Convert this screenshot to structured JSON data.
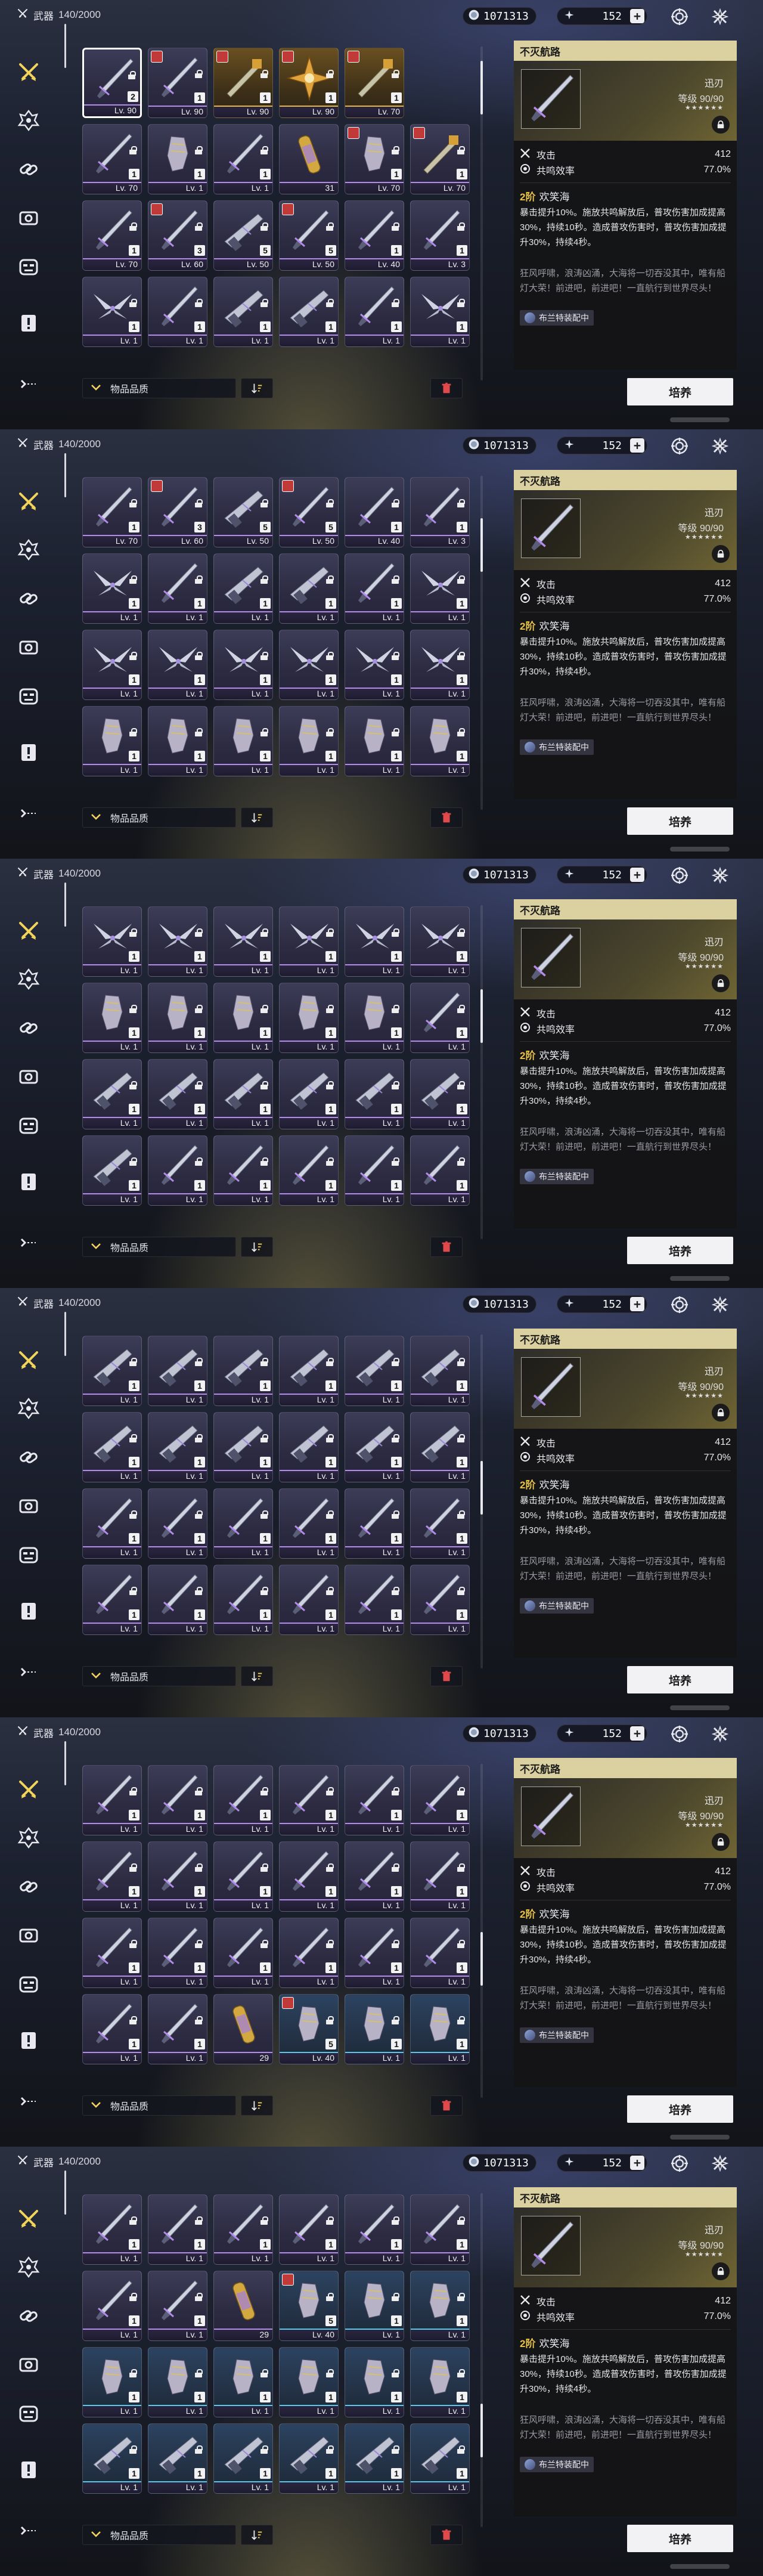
{
  "header": {
    "title": "武器",
    "count": "140/2000",
    "credits": "1071313",
    "gems": "152"
  },
  "filter": {
    "label": "物品品质"
  },
  "detail": {
    "name": "不灭航路",
    "type": "迅刃",
    "level": "等级 90/90",
    "stars": "★★★★★★",
    "stats": [
      {
        "label": "攻击",
        "value": "412"
      },
      {
        "label": "共鸣效率",
        "value": "77.0%"
      }
    ],
    "skill_tier": "2阶",
    "skill_name": "欢笑海",
    "skill_desc": "暴击提升10%。施放共鸣解放后，普攻伤害加成提高30%，持续10秒。造成普攻伤害时，普攻伤害加成提升30%，持续4秒。",
    "flavor": "狂风呼啸，浪涛凶涌，大海将一切吞没其中，唯有船灯大荣！前进吧，前进吧！一直航行到世界尽头！",
    "equipped_by": "布兰特装配中",
    "upgrade_label": "培养"
  },
  "panels": [
    {
      "thumb_row": 0,
      "rows": [
        [
          {
            "lv": "Lv. 90",
            "n": "2",
            "r": "p",
            "w": "sword",
            "sel": true,
            "badge": false
          },
          {
            "lv": "Lv. 90",
            "n": "1",
            "r": "p",
            "w": "sword",
            "badge": true
          },
          {
            "lv": "Lv. 90",
            "n": "1",
            "r": "g",
            "w": "rect",
            "badge": true
          },
          {
            "lv": "Lv. 90",
            "n": "1",
            "r": "g",
            "w": "star",
            "badge": true
          },
          {
            "lv": "Lv. 70",
            "n": "1",
            "r": "g",
            "w": "rect",
            "badge": true
          }
        ],
        [
          {
            "lv": "Lv. 70",
            "n": "1",
            "r": "p",
            "w": "sword"
          },
          {
            "lv": "Lv. 1",
            "n": "1",
            "r": "p",
            "w": "gauntlet"
          },
          {
            "lv": "Lv. 1",
            "n": "1",
            "r": "p",
            "w": "sword"
          },
          {
            "lv": "31",
            "n": "",
            "r": "p",
            "w": "tube"
          },
          {
            "lv": "Lv. 70",
            "n": "1",
            "r": "p",
            "w": "gauntlet",
            "badge": true
          },
          {
            "lv": "Lv. 70",
            "n": "1",
            "r": "p",
            "w": "rect",
            "badge": true
          }
        ],
        [
          {
            "lv": "Lv. 70",
            "n": "1",
            "r": "p",
            "w": "sword"
          },
          {
            "lv": "Lv. 60",
            "n": "3",
            "r": "p",
            "w": "sword",
            "badge": true
          },
          {
            "lv": "Lv. 50",
            "n": "5",
            "r": "p",
            "w": "gun"
          },
          {
            "lv": "Lv. 50",
            "n": "5",
            "r": "p",
            "w": "sword",
            "badge": true
          },
          {
            "lv": "Lv. 40",
            "n": "1",
            "r": "p",
            "w": "sword"
          },
          {
            "lv": "Lv. 3",
            "n": "1",
            "r": "p",
            "w": "sword"
          }
        ],
        [
          {
            "lv": "Lv. 1",
            "n": "1",
            "r": "p",
            "w": "wing"
          },
          {
            "lv": "Lv. 1",
            "n": "1",
            "r": "p",
            "w": "sword"
          },
          {
            "lv": "Lv. 1",
            "n": "1",
            "r": "p",
            "w": "gun"
          },
          {
            "lv": "Lv. 1",
            "n": "1",
            "r": "p",
            "w": "gun"
          },
          {
            "lv": "Lv. 1",
            "n": "1",
            "r": "p",
            "w": "sword"
          },
          {
            "lv": "Lv. 1",
            "n": "1",
            "r": "p",
            "w": "wing"
          }
        ]
      ],
      "thumb_top": 0.05
    },
    {
      "rows": [
        [
          {
            "lv": "Lv. 70",
            "n": "1",
            "r": "p",
            "w": "sword"
          },
          {
            "lv": "Lv. 60",
            "n": "3",
            "r": "p",
            "w": "sword",
            "badge": true
          },
          {
            "lv": "Lv. 50",
            "n": "5",
            "r": "p",
            "w": "gun"
          },
          {
            "lv": "Lv. 50",
            "n": "5",
            "r": "p",
            "w": "sword",
            "badge": true
          },
          {
            "lv": "Lv. 40",
            "n": "1",
            "r": "p",
            "w": "sword"
          },
          {
            "lv": "Lv. 3",
            "n": "1",
            "r": "p",
            "w": "sword"
          }
        ],
        [
          {
            "lv": "Lv. 1",
            "n": "1",
            "r": "p",
            "w": "wing"
          },
          {
            "lv": "Lv. 1",
            "n": "1",
            "r": "p",
            "w": "sword"
          },
          {
            "lv": "Lv. 1",
            "n": "1",
            "r": "p",
            "w": "gun"
          },
          {
            "lv": "Lv. 1",
            "n": "1",
            "r": "p",
            "w": "gun"
          },
          {
            "lv": "Lv. 1",
            "n": "1",
            "r": "p",
            "w": "sword"
          },
          {
            "lv": "Lv. 1",
            "n": "1",
            "r": "p",
            "w": "wing"
          }
        ],
        [
          {
            "lv": "Lv. 1",
            "n": "1",
            "r": "p",
            "w": "wing"
          },
          {
            "lv": "Lv. 1",
            "n": "1",
            "r": "p",
            "w": "wing"
          },
          {
            "lv": "Lv. 1",
            "n": "1",
            "r": "p",
            "w": "wing"
          },
          {
            "lv": "Lv. 1",
            "n": "1",
            "r": "p",
            "w": "wing"
          },
          {
            "lv": "Lv. 1",
            "n": "1",
            "r": "p",
            "w": "wing"
          },
          {
            "lv": "Lv. 1",
            "n": "1",
            "r": "p",
            "w": "wing"
          }
        ],
        [
          {
            "lv": "Lv. 1",
            "n": "1",
            "r": "p",
            "w": "gauntlet"
          },
          {
            "lv": "Lv. 1",
            "n": "1",
            "r": "p",
            "w": "gauntlet"
          },
          {
            "lv": "Lv. 1",
            "n": "1",
            "r": "p",
            "w": "gauntlet"
          },
          {
            "lv": "Lv. 1",
            "n": "1",
            "r": "p",
            "w": "gauntlet"
          },
          {
            "lv": "Lv. 1",
            "n": "1",
            "r": "p",
            "w": "gauntlet"
          },
          {
            "lv": "Lv. 1",
            "n": "1",
            "r": "p",
            "w": "gauntlet"
          }
        ]
      ],
      "thumb_top": 0.15
    },
    {
      "rows": [
        [
          {
            "lv": "Lv. 1",
            "n": "1",
            "r": "p",
            "w": "wing"
          },
          {
            "lv": "Lv. 1",
            "n": "1",
            "r": "p",
            "w": "wing"
          },
          {
            "lv": "Lv. 1",
            "n": "1",
            "r": "p",
            "w": "wing"
          },
          {
            "lv": "Lv. 1",
            "n": "1",
            "r": "p",
            "w": "wing"
          },
          {
            "lv": "Lv. 1",
            "n": "1",
            "r": "p",
            "w": "wing"
          },
          {
            "lv": "Lv. 1",
            "n": "1",
            "r": "p",
            "w": "wing"
          }
        ],
        [
          {
            "lv": "Lv. 1",
            "n": "1",
            "r": "p",
            "w": "gauntlet"
          },
          {
            "lv": "Lv. 1",
            "n": "1",
            "r": "p",
            "w": "gauntlet"
          },
          {
            "lv": "Lv. 1",
            "n": "1",
            "r": "p",
            "w": "gauntlet"
          },
          {
            "lv": "Lv. 1",
            "n": "1",
            "r": "p",
            "w": "gauntlet"
          },
          {
            "lv": "Lv. 1",
            "n": "1",
            "r": "p",
            "w": "gauntlet"
          },
          {
            "lv": "Lv. 1",
            "n": "1",
            "r": "p",
            "w": "sword"
          }
        ],
        [
          {
            "lv": "Lv. 1",
            "n": "1",
            "r": "p",
            "w": "gun"
          },
          {
            "lv": "Lv. 1",
            "n": "1",
            "r": "p",
            "w": "gun"
          },
          {
            "lv": "Lv. 1",
            "n": "1",
            "r": "p",
            "w": "gun"
          },
          {
            "lv": "Lv. 1",
            "n": "1",
            "r": "p",
            "w": "gun"
          },
          {
            "lv": "Lv. 1",
            "n": "1",
            "r": "p",
            "w": "gun"
          },
          {
            "lv": "Lv. 1",
            "n": "1",
            "r": "p",
            "w": "gun"
          }
        ],
        [
          {
            "lv": "Lv. 1",
            "n": "1",
            "r": "p",
            "w": "gun"
          },
          {
            "lv": "Lv. 1",
            "n": "1",
            "r": "p",
            "w": "sword"
          },
          {
            "lv": "Lv. 1",
            "n": "1",
            "r": "p",
            "w": "sword"
          },
          {
            "lv": "Lv. 1",
            "n": "1",
            "r": "p",
            "w": "sword"
          },
          {
            "lv": "Lv. 1",
            "n": "1",
            "r": "p",
            "w": "sword"
          },
          {
            "lv": "Lv. 1",
            "n": "1",
            "r": "p",
            "w": "sword"
          }
        ]
      ],
      "thumb_top": 0.3
    },
    {
      "rows": [
        [
          {
            "lv": "Lv. 1",
            "n": "1",
            "r": "p",
            "w": "gun"
          },
          {
            "lv": "Lv. 1",
            "n": "1",
            "r": "p",
            "w": "gun"
          },
          {
            "lv": "Lv. 1",
            "n": "1",
            "r": "p",
            "w": "gun"
          },
          {
            "lv": "Lv. 1",
            "n": "1",
            "r": "p",
            "w": "gun"
          },
          {
            "lv": "Lv. 1",
            "n": "1",
            "r": "p",
            "w": "gun"
          },
          {
            "lv": "Lv. 1",
            "n": "1",
            "r": "p",
            "w": "gun"
          }
        ],
        [
          {
            "lv": "Lv. 1",
            "n": "1",
            "r": "p",
            "w": "gun"
          },
          {
            "lv": "Lv. 1",
            "n": "1",
            "r": "p",
            "w": "gun"
          },
          {
            "lv": "Lv. 1",
            "n": "1",
            "r": "p",
            "w": "gun"
          },
          {
            "lv": "Lv. 1",
            "n": "1",
            "r": "p",
            "w": "gun"
          },
          {
            "lv": "Lv. 1",
            "n": "1",
            "r": "p",
            "w": "gun"
          },
          {
            "lv": "Lv. 1",
            "n": "1",
            "r": "p",
            "w": "gun"
          }
        ],
        [
          {
            "lv": "Lv. 1",
            "n": "1",
            "r": "p",
            "w": "sword"
          },
          {
            "lv": "Lv. 1",
            "n": "1",
            "r": "p",
            "w": "sword"
          },
          {
            "lv": "Lv. 1",
            "n": "1",
            "r": "p",
            "w": "sword"
          },
          {
            "lv": "Lv. 1",
            "n": "1",
            "r": "p",
            "w": "sword"
          },
          {
            "lv": "Lv. 1",
            "n": "1",
            "r": "p",
            "w": "sword"
          },
          {
            "lv": "Lv. 1",
            "n": "1",
            "r": "p",
            "w": "sword"
          }
        ],
        [
          {
            "lv": "Lv. 1",
            "n": "1",
            "r": "p",
            "w": "sword"
          },
          {
            "lv": "Lv. 1",
            "n": "1",
            "r": "p",
            "w": "sword"
          },
          {
            "lv": "Lv. 1",
            "n": "1",
            "r": "p",
            "w": "sword"
          },
          {
            "lv": "Lv. 1",
            "n": "1",
            "r": "p",
            "w": "sword"
          },
          {
            "lv": "Lv. 1",
            "n": "1",
            "r": "p",
            "w": "sword"
          },
          {
            "lv": "Lv. 1",
            "n": "1",
            "r": "p",
            "w": "sword"
          }
        ]
      ],
      "thumb_top": 0.45
    },
    {
      "rows": [
        [
          {
            "lv": "Lv. 1",
            "n": "1",
            "r": "p",
            "w": "sword"
          },
          {
            "lv": "Lv. 1",
            "n": "1",
            "r": "p",
            "w": "sword"
          },
          {
            "lv": "Lv. 1",
            "n": "1",
            "r": "p",
            "w": "sword"
          },
          {
            "lv": "Lv. 1",
            "n": "1",
            "r": "p",
            "w": "sword"
          },
          {
            "lv": "Lv. 1",
            "n": "1",
            "r": "p",
            "w": "sword"
          },
          {
            "lv": "Lv. 1",
            "n": "1",
            "r": "p",
            "w": "sword"
          }
        ],
        [
          {
            "lv": "Lv. 1",
            "n": "1",
            "r": "p",
            "w": "sword"
          },
          {
            "lv": "Lv. 1",
            "n": "1",
            "r": "p",
            "w": "sword"
          },
          {
            "lv": "Lv. 1",
            "n": "1",
            "r": "p",
            "w": "sword"
          },
          {
            "lv": "Lv. 1",
            "n": "1",
            "r": "p",
            "w": "sword"
          },
          {
            "lv": "Lv. 1",
            "n": "1",
            "r": "p",
            "w": "sword"
          },
          {
            "lv": "Lv. 1",
            "n": "1",
            "r": "p",
            "w": "sword"
          }
        ],
        [
          {
            "lv": "Lv. 1",
            "n": "1",
            "r": "p",
            "w": "sword"
          },
          {
            "lv": "Lv. 1",
            "n": "1",
            "r": "p",
            "w": "sword"
          },
          {
            "lv": "Lv. 1",
            "n": "1",
            "r": "p",
            "w": "sword"
          },
          {
            "lv": "Lv. 1",
            "n": "1",
            "r": "p",
            "w": "sword"
          },
          {
            "lv": "Lv. 1",
            "n": "1",
            "r": "p",
            "w": "sword"
          },
          {
            "lv": "Lv. 1",
            "n": "1",
            "r": "p",
            "w": "sword"
          }
        ],
        [
          {
            "lv": "Lv. 1",
            "n": "1",
            "r": "p",
            "w": "sword"
          },
          {
            "lv": "Lv. 1",
            "n": "1",
            "r": "p",
            "w": "sword"
          },
          {
            "lv": "29",
            "n": "",
            "r": "p",
            "w": "tube"
          },
          {
            "lv": "Lv. 40",
            "n": "5",
            "r": "b",
            "w": "gauntlet",
            "badge": true
          },
          {
            "lv": "Lv. 1",
            "n": "1",
            "r": "b",
            "w": "gauntlet"
          },
          {
            "lv": "Lv. 1",
            "n": "1",
            "r": "b",
            "w": "gauntlet"
          }
        ]
      ],
      "thumb_top": 0.6
    },
    {
      "rows": [
        [
          {
            "lv": "Lv. 1",
            "n": "1",
            "r": "p",
            "w": "sword"
          },
          {
            "lv": "Lv. 1",
            "n": "1",
            "r": "p",
            "w": "sword"
          },
          {
            "lv": "Lv. 1",
            "n": "1",
            "r": "p",
            "w": "sword"
          },
          {
            "lv": "Lv. 1",
            "n": "1",
            "r": "p",
            "w": "sword"
          },
          {
            "lv": "Lv. 1",
            "n": "1",
            "r": "p",
            "w": "sword"
          },
          {
            "lv": "Lv. 1",
            "n": "1",
            "r": "p",
            "w": "sword"
          }
        ],
        [
          {
            "lv": "Lv. 1",
            "n": "1",
            "r": "p",
            "w": "sword"
          },
          {
            "lv": "Lv. 1",
            "n": "1",
            "r": "p",
            "w": "sword"
          },
          {
            "lv": "29",
            "n": "",
            "r": "p",
            "w": "tube"
          },
          {
            "lv": "Lv. 40",
            "n": "5",
            "r": "b",
            "w": "gauntlet",
            "badge": true
          },
          {
            "lv": "Lv. 1",
            "n": "1",
            "r": "b",
            "w": "gauntlet"
          },
          {
            "lv": "Lv. 1",
            "n": "1",
            "r": "b",
            "w": "gauntlet"
          }
        ],
        [
          {
            "lv": "Lv. 1",
            "n": "1",
            "r": "b",
            "w": "gauntlet"
          },
          {
            "lv": "Lv. 1",
            "n": "1",
            "r": "b",
            "w": "gauntlet"
          },
          {
            "lv": "Lv. 1",
            "n": "1",
            "r": "b",
            "w": "gauntlet"
          },
          {
            "lv": "Lv. 1",
            "n": "1",
            "r": "b",
            "w": "gauntlet"
          },
          {
            "lv": "Lv. 1",
            "n": "1",
            "r": "b",
            "w": "gauntlet"
          },
          {
            "lv": "Lv. 1",
            "n": "1",
            "r": "b",
            "w": "gauntlet"
          }
        ],
        [
          {
            "lv": "Lv. 1",
            "n": "1",
            "r": "b",
            "w": "gun"
          },
          {
            "lv": "Lv. 1",
            "n": "1",
            "r": "b",
            "w": "gun"
          },
          {
            "lv": "Lv. 1",
            "n": "1",
            "r": "b",
            "w": "gun"
          },
          {
            "lv": "Lv. 1",
            "n": "1",
            "r": "b",
            "w": "gun"
          },
          {
            "lv": "Lv. 1",
            "n": "1",
            "r": "b",
            "w": "gun"
          },
          {
            "lv": "Lv. 1",
            "n": "1",
            "r": "b",
            "w": "gun"
          }
        ]
      ],
      "thumb_top": 0.75
    }
  ]
}
